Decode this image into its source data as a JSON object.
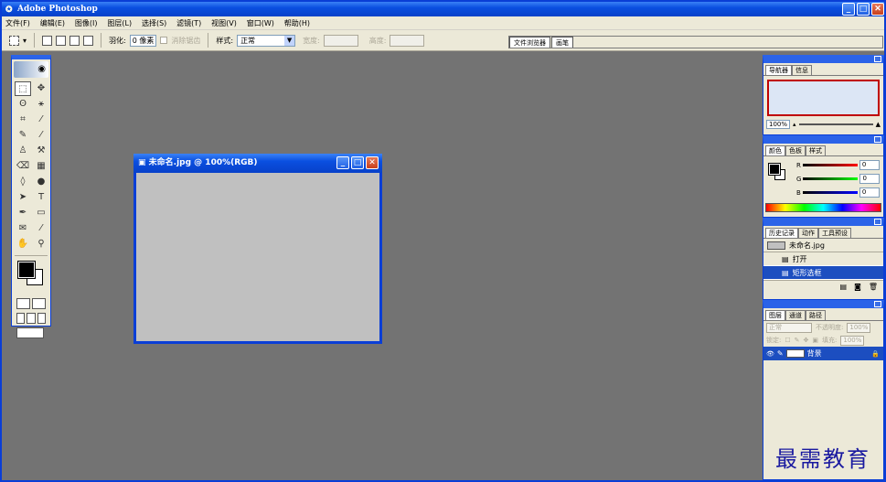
{
  "app": {
    "title": "Adobe Photoshop",
    "logo_glyph": "✪"
  },
  "window_controls": {
    "minimize": "_",
    "maximize": "□",
    "close": "✕"
  },
  "menubar": {
    "items": [
      "文件(F)",
      "编辑(E)",
      "图像(I)",
      "图层(L)",
      "选择(S)",
      "滤镜(T)",
      "视图(V)",
      "窗口(W)",
      "帮助(H)"
    ]
  },
  "options_bar": {
    "marquee_dropdown": "▾",
    "feather_label": "羽化:",
    "feather_value": "0 像素",
    "antialias_label": "消除锯齿",
    "style_label": "样式:",
    "style_value": "正常",
    "width_label": "宽度:",
    "height_label": "高度:",
    "palette_tabs": [
      "文件浏览器",
      "画笔"
    ]
  },
  "toolbox": {
    "tools": [
      {
        "name": "marquee-tool",
        "glyph": "⬚",
        "sel": true
      },
      {
        "name": "move-tool",
        "glyph": "✥",
        "sel": false
      },
      {
        "name": "lasso-tool",
        "glyph": "ʘ",
        "sel": false
      },
      {
        "name": "magic-wand-tool",
        "glyph": "⚹",
        "sel": false
      },
      {
        "name": "crop-tool",
        "glyph": "⌗",
        "sel": false
      },
      {
        "name": "slice-tool",
        "glyph": "⁄",
        "sel": false
      },
      {
        "name": "healing-brush-tool",
        "glyph": "✎",
        "sel": false
      },
      {
        "name": "brush-tool",
        "glyph": "⁄",
        "sel": false
      },
      {
        "name": "clone-stamp-tool",
        "glyph": "♙",
        "sel": false
      },
      {
        "name": "history-brush-tool",
        "glyph": "⚒",
        "sel": false
      },
      {
        "name": "eraser-tool",
        "glyph": "⌫",
        "sel": false
      },
      {
        "name": "gradient-tool",
        "glyph": "▦",
        "sel": false
      },
      {
        "name": "blur-tool",
        "glyph": "◊",
        "sel": false
      },
      {
        "name": "dodge-tool",
        "glyph": "●",
        "sel": false
      },
      {
        "name": "path-selection-tool",
        "glyph": "➤",
        "sel": false
      },
      {
        "name": "type-tool",
        "glyph": "T",
        "sel": false
      },
      {
        "name": "pen-tool",
        "glyph": "✒",
        "sel": false
      },
      {
        "name": "rectangle-tool",
        "glyph": "▭",
        "sel": false
      },
      {
        "name": "notes-tool",
        "glyph": "✉",
        "sel": false
      },
      {
        "name": "eyedropper-tool",
        "glyph": "⁄",
        "sel": false
      },
      {
        "name": "hand-tool",
        "glyph": "✋",
        "sel": false
      },
      {
        "name": "zoom-tool",
        "glyph": "⚲",
        "sel": false
      }
    ]
  },
  "document": {
    "title": "未命名.jpg @ 100%(RGB)",
    "icon": "▣"
  },
  "navigator": {
    "tabs": [
      "导航器",
      "信息"
    ],
    "zoom": "100%"
  },
  "color": {
    "tabs": [
      "颜色",
      "色板",
      "样式"
    ],
    "channels": [
      {
        "label": "R",
        "value": "0",
        "color": "linear-gradient(90deg,#000,#ff0000)"
      },
      {
        "label": "G",
        "value": "0",
        "color": "linear-gradient(90deg,#000,#00ff00)"
      },
      {
        "label": "B",
        "value": "0",
        "color": "linear-gradient(90deg,#000,#0000ff)"
      }
    ]
  },
  "history": {
    "tabs": [
      "历史记录",
      "动作",
      "工具预设"
    ],
    "snapshot": "未命名.jpg",
    "items": [
      {
        "label": "打开",
        "selected": false
      },
      {
        "label": "矩形选框",
        "selected": true
      }
    ]
  },
  "layers": {
    "tabs": [
      "图层",
      "通道",
      "路径"
    ],
    "blend_mode": "正常",
    "opacity_label": "不透明度:",
    "opacity": "100%",
    "lock_label": "锁定:",
    "fill_label": "填充:",
    "fill": "100%",
    "layer_name": "背景",
    "eye_glyph": "👁",
    "lock_glyph": "🔒"
  },
  "watermark": "最需教育"
}
